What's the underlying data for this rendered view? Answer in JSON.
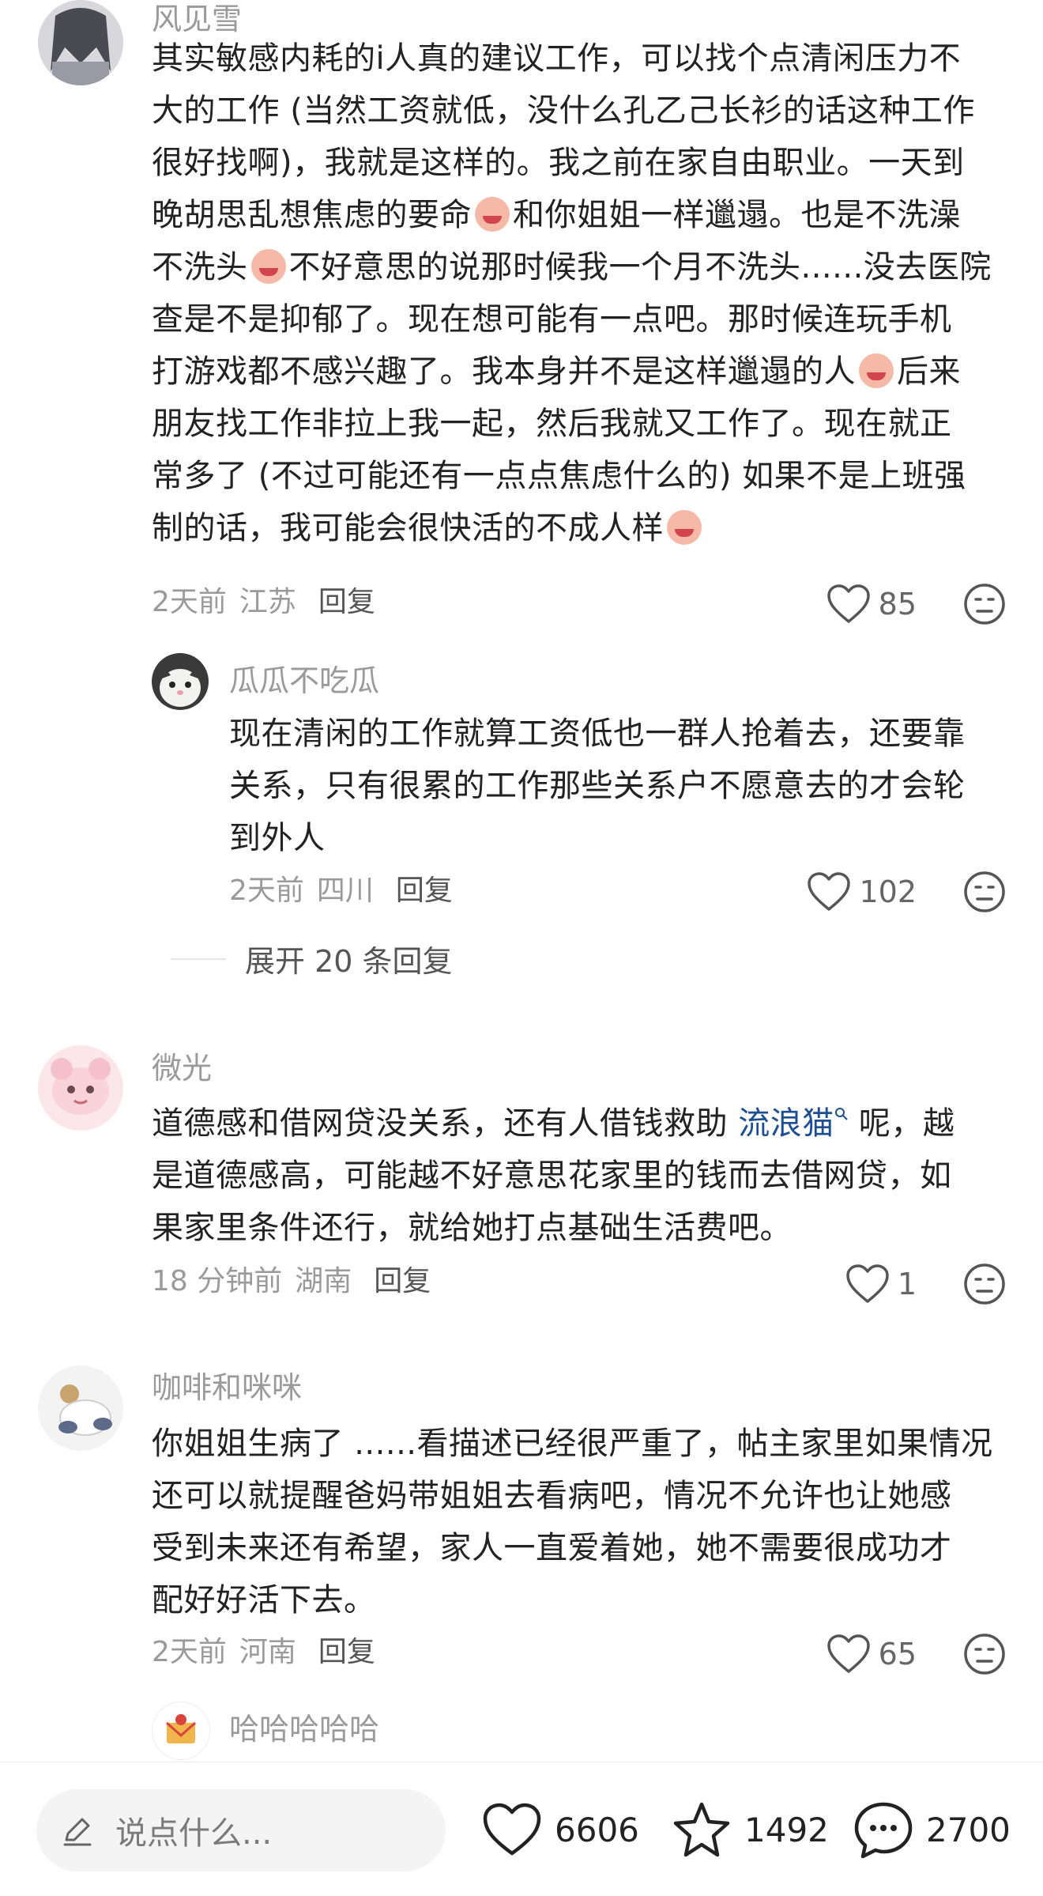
{
  "comments": [
    {
      "author": "风见雪",
      "lines": [
        "其实敏感内耗的i人真的建议工作，可以找个点清闲压力不",
        "大的工作 (当然工资就低，没什么孔乙己长衫的话这种工作",
        "很好找啊)，我就是这样的。我之前在家自由职业。一天到",
        "晚胡思乱想焦虑的要命",
        "和你姐姐一样邋遢。也是不洗澡",
        "不洗头",
        "不好意思的说那时候我一个月不洗头......没去医院",
        "查是不是抑郁了。现在想可能有一点吧。那时候连玩手机",
        "打游戏都不感兴趣了。我本身并不是这样邋遢的人",
        "后来",
        "朋友找工作非拉上我一起，然后我就又工作了。现在就正",
        "常多了 (不过可能还有一点点焦虑什么的) 如果不是上班强",
        "制的话，我可能会很快活的不成人样"
      ],
      "time": "2天前",
      "location": "江苏",
      "reply_label": "回复",
      "likes": "85",
      "reply": {
        "author": "瓜瓜不吃瓜",
        "lines": [
          "现在清闲的工作就算工资低也一群人抢着去，还要靠",
          "关系，只有很累的工作那些关系户不愿意去的才会轮",
          "到外人"
        ],
        "time": "2天前",
        "location": "四川",
        "reply_label": "回复",
        "likes": "102"
      },
      "expand_label": "展开 20 条回复"
    },
    {
      "author": "微光",
      "line1_pre": "道德感和借网贷没关系，还有人借钱救助 ",
      "link": "流浪猫",
      "line1_post": " 呢，越",
      "line2": "是道德感高，可能越不好意思花家里的钱而去借网贷，如",
      "line3": "果家里条件还行，就给她打点基础生活费吧。",
      "time": "18 分钟前",
      "location": "湖南",
      "reply_label": "回复",
      "likes": "1"
    },
    {
      "author": "咖啡和咪咪",
      "lines": [
        "你姐姐生病了 ......看描述已经很严重了，帖主家里如果情况",
        "还可以就提醒爸妈带姐姐去看病吧，情况不允许也让她感",
        "受到未来还有希望，家人一直爱着她，她不需要很成功才",
        "配好好活下去。"
      ],
      "time": "2天前",
      "location": "河南",
      "reply_label": "回复",
      "likes": "65",
      "reply": {
        "author": "哈哈哈哈哈"
      }
    }
  ],
  "bottom_bar": {
    "placeholder": "说点什么...",
    "likes": "6606",
    "favorites": "1492",
    "comments": "2700"
  },
  "colors": {
    "link": "#1d4e93",
    "muted": "#9a9a9a",
    "text": "#222222"
  }
}
